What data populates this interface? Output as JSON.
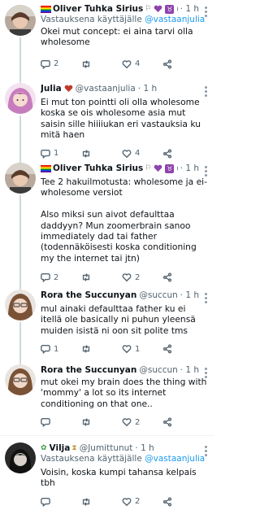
{
  "tweets": [
    {
      "name": "Oliver Tuhka Sirius",
      "handle": "@...",
      "time": "· 1 h",
      "reply_label": "Vastauksena käyttäjälle",
      "reply_handle": "@vastaanjulia",
      "text": "Okei mut concept: ei aina tarvi olla wholesome",
      "replies": "2",
      "retweets": "",
      "likes": "4"
    },
    {
      "name": "Julia",
      "handle": "@vastaanjulia",
      "time": "· 1 h",
      "text": "Ei mut ton pointti oli olla wholesome koska se ois wholesome asia mut saisin sille hiiiiukan eri vastauksia ku mitä haen",
      "replies": "1",
      "retweets": "",
      "likes": "4"
    },
    {
      "name": "Oliver Tuhka Sirius",
      "handle": "@...",
      "time": "· 1 h",
      "text": "Tee 2 hakuilmotusta: wholesome ja ei-wholesome versiot\n\nAlso miksi sun aivot defaulttaa daddyyn? Mun zoomerbrain sanoo immediately dad tai father (todennäköisesti koska conditioning my the internet tai jtn)",
      "replies": "2",
      "retweets": "",
      "likes": "2"
    },
    {
      "name": "Rora the Succunyan",
      "handle": "@succun...",
      "time": "· 1 h",
      "text": "mul ainaki defaulttaa father ku ei itellä ole basically ni puhun yleensä muiden isistä ni oon sit polite tms",
      "replies": "1",
      "retweets": "",
      "likes": "1"
    },
    {
      "name": "Rora the Succunyan",
      "handle": "@succun...",
      "time": "· 1 h",
      "text": "mut okei my brain does the thing with 'mommy' a lot so its internet conditioning on that one..",
      "replies": "",
      "retweets": "",
      "likes": "2"
    },
    {
      "name": "Vilja",
      "handle": "@Jumittunut",
      "time": "· 1 h",
      "reply_label": "Vastauksena käyttäjälle",
      "reply_handle": "@vastaanjulia",
      "text": "Voisin, koska kumpi tahansa kelpais tbh",
      "replies": "",
      "retweets": "",
      "likes": "2"
    }
  ],
  "icons": {
    "reply": "reply-icon",
    "retweet": "retweet-icon",
    "like": "heart-icon",
    "share": "share-icon"
  }
}
